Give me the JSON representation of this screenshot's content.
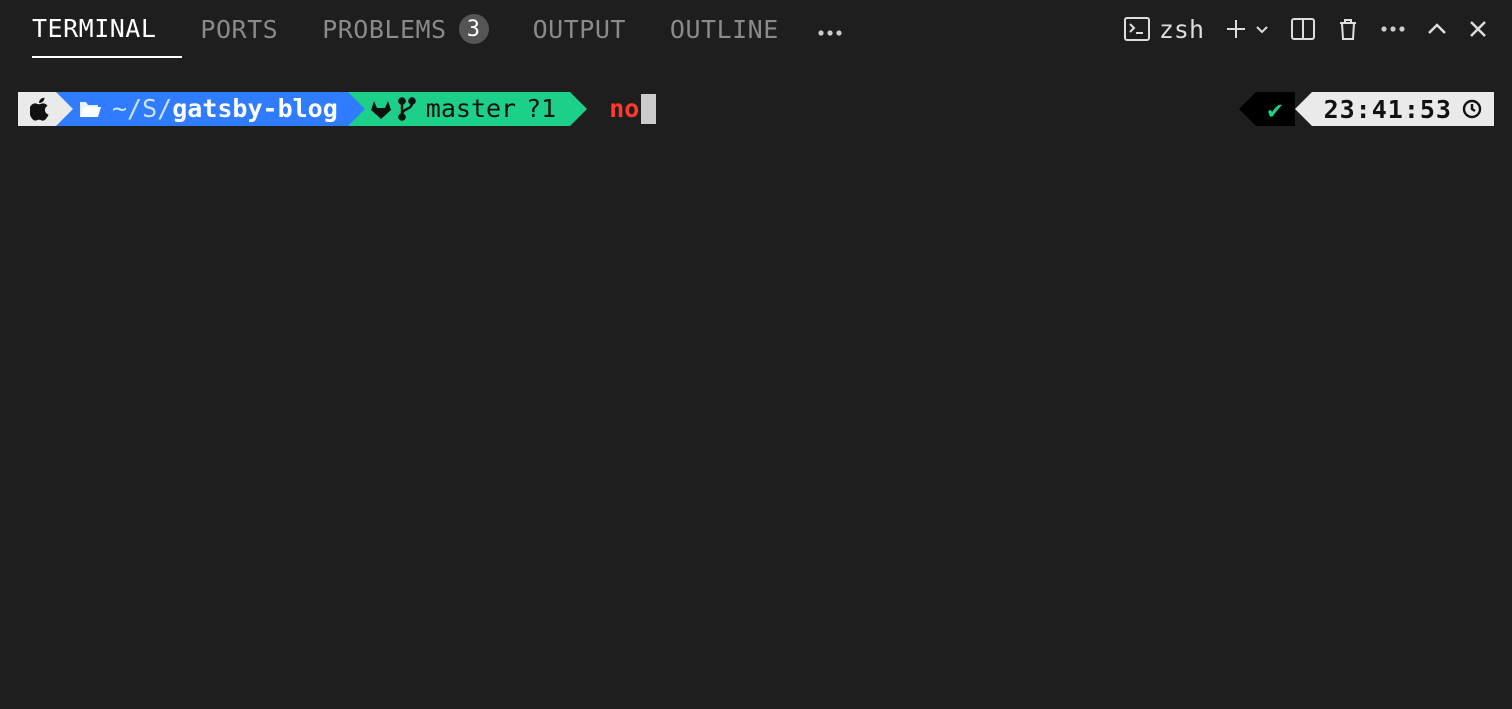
{
  "tabs": {
    "terminal": "TERMINAL",
    "ports": "PORTS",
    "problems": "PROBLEMS",
    "problems_badge": "3",
    "output": "OUTPUT",
    "outline": "OUTLINE"
  },
  "toolbar": {
    "shell_name": "zsh"
  },
  "prompt": {
    "path_prefix": "~/S/",
    "path_dir": "gatsby-blog",
    "git_branch": "master",
    "git_status": "?1",
    "typed": "no",
    "right_check": "✔",
    "time": "23:41:53"
  }
}
